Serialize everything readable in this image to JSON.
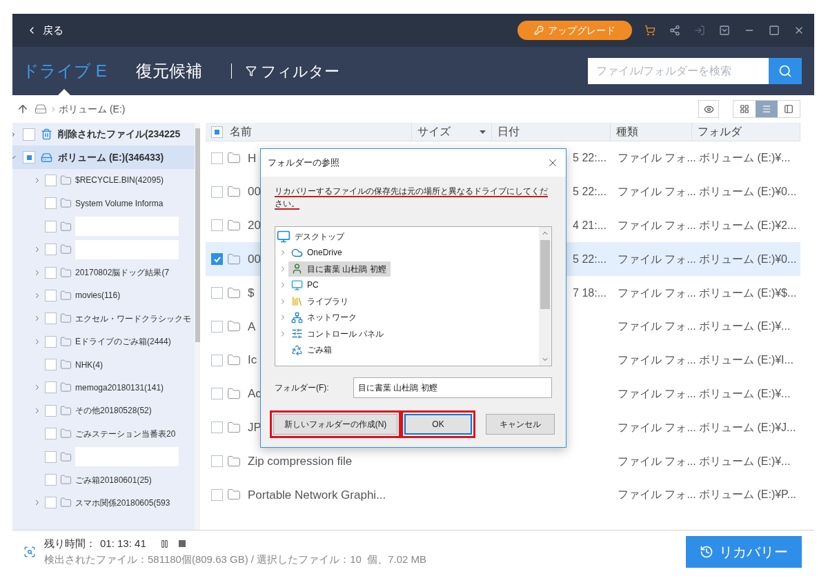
{
  "titlebar": {
    "back": "戻る",
    "upgrade": "アップグレード",
    "icons": [
      {
        "kind": "cart",
        "disabled": false
      },
      {
        "kind": "share",
        "disabled": false
      },
      {
        "kind": "signin",
        "disabled": true
      },
      {
        "kind": "dropdown",
        "disabled": false
      },
      {
        "kind": "minimize",
        "disabled": false
      },
      {
        "kind": "maximize",
        "disabled": false
      },
      {
        "kind": "close",
        "disabled": false
      }
    ]
  },
  "nav": {
    "tabs": [
      {
        "label": "ドライブ E",
        "selected": true
      },
      {
        "label": "復元候補",
        "selected": false
      }
    ],
    "filter": "フィルター",
    "search": {
      "placeholder": "ファイル/フォルダーを検索"
    }
  },
  "breadcrumb": {
    "path": "ボリューム (E:)",
    "views": [
      {
        "kind": "grid",
        "selected": false
      },
      {
        "kind": "list",
        "selected": true
      },
      {
        "kind": "panel",
        "selected": false
      }
    ]
  },
  "tree": [
    {
      "label": "削除されたファイル(234225",
      "kind": "deleted",
      "expanded": false,
      "checked": false,
      "partial": false,
      "selected": false
    },
    {
      "label": "ボリューム (E:)(346433)",
      "kind": "volume",
      "expanded": true,
      "checked": false,
      "partial": true,
      "selected": true,
      "children": [
        {
          "label": "$RECYCLE.BIN(42095)",
          "expandable": true,
          "checked": false
        },
        {
          "label": "System Volume Informa",
          "expandable": false,
          "checked": false
        },
        {
          "kind": "redacted",
          "expandable": false,
          "checked": false
        },
        {
          "kind": "redacted",
          "expandable": true,
          "checked": false
        },
        {
          "label": "20170802脳ドッグ結果(7",
          "expandable": true,
          "checked": false
        },
        {
          "label": "movies(116)",
          "expandable": true,
          "checked": false
        },
        {
          "label": "エクセル・ワードクラシックモ",
          "expandable": true,
          "checked": false
        },
        {
          "label": "Eドライブのごみ箱(2444)",
          "expandable": true,
          "checked": false
        },
        {
          "label": "NHK(4)",
          "expandable": false,
          "checked": false
        },
        {
          "label": "memoga20180131(141)",
          "expandable": true,
          "checked": false
        },
        {
          "label": "その他20180528(52)",
          "expandable": true,
          "checked": false
        },
        {
          "label": "ごみステーション当番表20",
          "expandable": false,
          "checked": false
        },
        {
          "kind": "redacted",
          "expandable": false,
          "checked": false
        },
        {
          "label": "ごみ箱20180601(25)",
          "expandable": false,
          "checked": false
        },
        {
          "label": "スマホ関係20180605(593",
          "expandable": true,
          "checked": false
        }
      ]
    }
  ],
  "table": {
    "all_checked": false,
    "all_partial": true,
    "columns": [
      {
        "label": "名前",
        "sort": false
      },
      {
        "label": "サイズ",
        "sort": true
      },
      {
        "label": "日付",
        "sort": false
      },
      {
        "label": "種類",
        "sort": false
      },
      {
        "label": "フォルダ",
        "sort": false
      }
    ],
    "rows": [
      {
        "name": "H",
        "date": "5 22:...",
        "type": "ファイル フォ...",
        "folder": "ボリューム (E:)¥...",
        "checked": false
      },
      {
        "name": "00",
        "date": "5 22:...",
        "type": "ファイル フォ...",
        "folder": "ボリューム (E:)¥0...",
        "checked": false
      },
      {
        "name": "20",
        "date": "4 21:...",
        "type": "ファイル フォ...",
        "folder": "ボリューム (E:)¥2...",
        "checked": false
      },
      {
        "name": "00",
        "date": "5 22:...",
        "type": "ファイル フォ...",
        "folder": "ボリューム (E:)¥0...",
        "checked": true
      },
      {
        "name": "$",
        "date": "7 18:...",
        "type": "ファイル フォ...",
        "folder": "ボリューム (E:)¥$...",
        "checked": false
      },
      {
        "name": "A",
        "type": "ファイル フォ...",
        "folder": "ボリューム (E:)¥...",
        "checked": false
      },
      {
        "name": "Ic",
        "type": "ファイル フォ...",
        "folder": "ボリューム (E:)¥I...",
        "checked": false
      },
      {
        "name": "Ac",
        "type": "ファイル フォ...",
        "folder": "ボリューム (E:)¥...",
        "checked": false
      },
      {
        "name": "JP",
        "type": "ファイル フォ...",
        "folder": "ボリューム (E:)¥J...",
        "checked": false
      },
      {
        "name": "Zip compression file",
        "type": "ファイル フォ...",
        "folder": "ボリューム (E:)¥...",
        "checked": false
      },
      {
        "name": "Portable Network Graphi...",
        "type": "ファイル フォ...",
        "folder": "ボリューム (E:)¥P...",
        "checked": false
      }
    ]
  },
  "dialog": {
    "title": "フォルダーの参照",
    "message": "リカバリーするファイルの保存先は元の場所と異なるドライブにしてください。",
    "message_underlined": true,
    "folders": [
      {
        "label": "デスクトップ",
        "kind": "desktop",
        "selected": false,
        "children": [
          {
            "label": "OneDrive",
            "kind": "cloud",
            "expandable": true,
            "selected": false
          },
          {
            "label": "目に書葉 山杜鵑 初鰹",
            "kind": "user",
            "expandable": true,
            "selected": true
          },
          {
            "label": "PC",
            "kind": "pc",
            "expandable": true,
            "selected": false
          },
          {
            "label": "ライブラリ",
            "kind": "library",
            "expandable": true,
            "selected": false
          },
          {
            "label": "ネットワーク",
            "kind": "network",
            "expandable": true,
            "selected": false
          },
          {
            "label": "コントロール パネル",
            "kind": "control",
            "expandable": true,
            "selected": false
          },
          {
            "label": "ごみ箱",
            "kind": "recycle",
            "expandable": false,
            "selected": false
          }
        ]
      }
    ],
    "folder_label": "フォルダー(F):",
    "folder_value": "目に書葉 山杜鵑 初鰹",
    "buttons": [
      {
        "label": "新しいフォルダーの作成(N)",
        "highlighted": true,
        "default": false
      },
      {
        "label": "OK",
        "highlighted": true,
        "default": true
      },
      {
        "label": "キャンセル",
        "highlighted": false,
        "default": false
      }
    ]
  },
  "status": {
    "remaining_label": "残り時間：",
    "remaining": "01: 13: 41",
    "summary": "検出されたファイル：581180個(809.63 GB) / 選択したファイル：10  個、7.02 MB",
    "recover": "リカバリー"
  }
}
